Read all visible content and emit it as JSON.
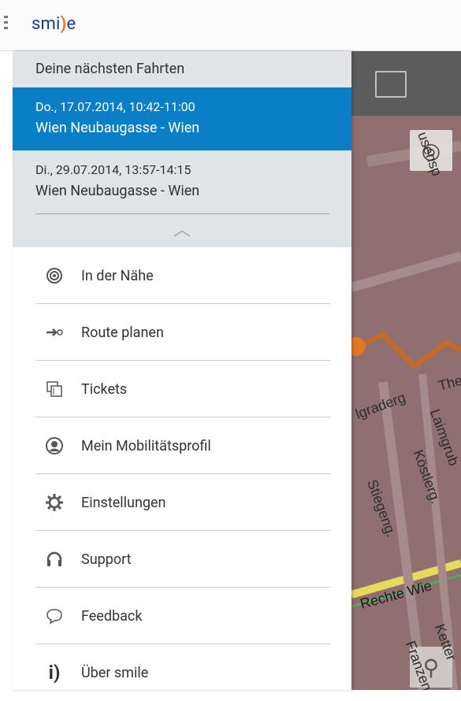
{
  "app": {
    "logo_text_left": "smi",
    "logo_paren": ")",
    "logo_text_right": "e"
  },
  "rides": {
    "header": "Deine nächsten Fahrten",
    "items": [
      {
        "date": "Do., 17.07.2014, 10:42-11:00",
        "route": "Wien Neubaugasse - Wien",
        "selected": true
      },
      {
        "date": "Di., 29.07.2014, 13:57-14:15",
        "route": "Wien Neubaugasse - Wien",
        "selected": false
      }
    ]
  },
  "menu": {
    "items": [
      {
        "label": "In der Nähe",
        "icon": "target-icon"
      },
      {
        "label": "Route planen",
        "icon": "route-arrow-icon"
      },
      {
        "label": "Tickets",
        "icon": "tickets-icon"
      },
      {
        "label": "Mein Mobilitätsprofil",
        "icon": "profile-icon"
      },
      {
        "label": "Einstellungen",
        "icon": "gear-icon"
      },
      {
        "label": "Support",
        "icon": "headset-icon"
      },
      {
        "label": "Feedback",
        "icon": "speech-bubble-icon"
      },
      {
        "label": "Über smile",
        "icon": "info-icon"
      }
    ]
  },
  "map": {
    "labels": [
      "Theo",
      "lgraderg",
      "Laimgrub",
      "Köstlerg.",
      "Stiegeng.",
      "Rechte Wie",
      "Ketter",
      "Franzen",
      "usensp"
    ]
  },
  "colors": {
    "accent": "#0a7fc8",
    "brand_blue": "#1a3f8a",
    "brand_orange": "#f27c1a"
  }
}
